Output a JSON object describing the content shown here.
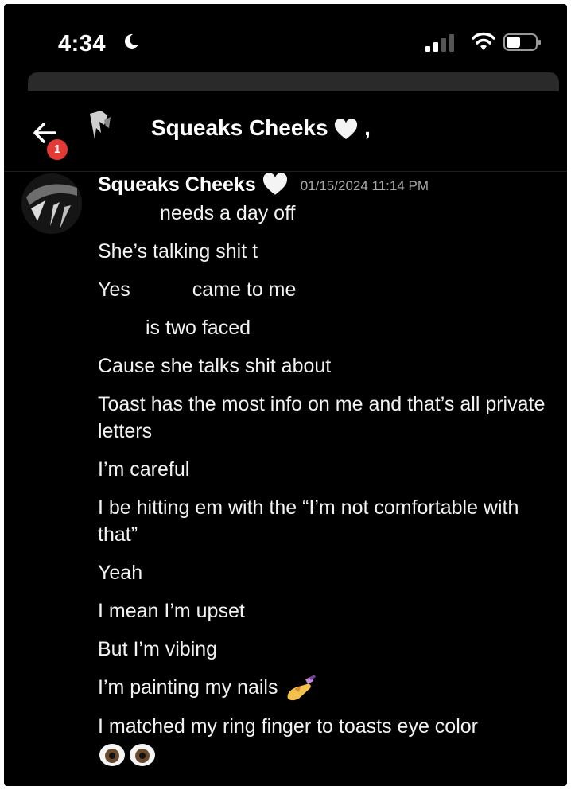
{
  "status_bar": {
    "time": "4:34"
  },
  "header": {
    "title": "Squeaks Cheeks",
    "title_suffix": ",",
    "badge_count": "1"
  },
  "message_group": {
    "author": "Squeaks Cheeks",
    "timestamp": "01/15/2024 11:14 PM",
    "messages": [
      {
        "text": "needs a day off"
      },
      {
        "text": "She’s talking shit t"
      },
      {
        "text_before": "Yes",
        "text_after": "came to me"
      },
      {
        "text": "is two faced"
      },
      {
        "text": "Cause she talks shit about"
      },
      {
        "text": "Toast has the most info on me and that’s all private letters"
      },
      {
        "text": "I’m careful"
      },
      {
        "text": "I be hitting em with the “I’m not comfortable with that”"
      },
      {
        "text": "Yeah"
      },
      {
        "text": "I mean I’m upset"
      },
      {
        "text": "But I’m vibing"
      },
      {
        "text": "I’m painting my nails",
        "emoji": "nail-polish-emoji"
      },
      {
        "text": "I matched my ring finger to toasts eye color",
        "emoji": "eyes-emoji"
      }
    ]
  },
  "colors": {
    "background": "#000000",
    "badge": "#e53935",
    "timestamp": "#a9a9a9"
  }
}
